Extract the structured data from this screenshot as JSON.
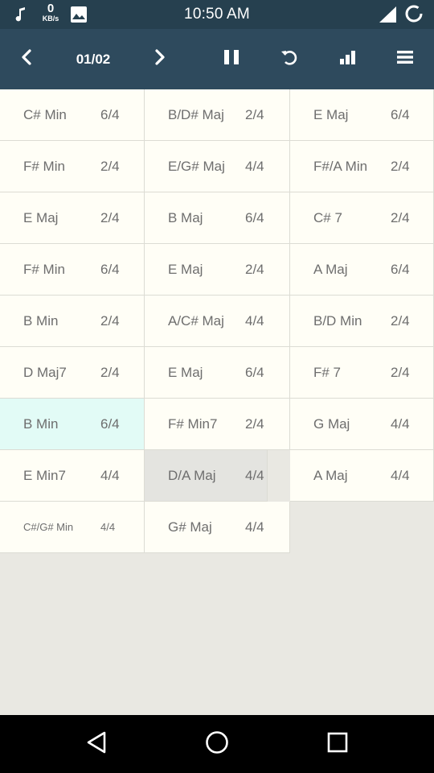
{
  "status_bar": {
    "time": "10:50 AM",
    "network_speed_value": "0",
    "network_speed_unit": "KB/s",
    "icons": [
      "music-note-icon",
      "image-icon",
      "signal-icon",
      "battery-loading-icon"
    ]
  },
  "toolbar": {
    "page_indicator": "01/02",
    "icons": [
      "chevron-left-icon",
      "chevron-right-icon",
      "pause-icon",
      "repeat-icon",
      "bar-chart-icon",
      "menu-icon"
    ]
  },
  "chords": [
    {
      "chord": "C# Min",
      "beat": "6/4"
    },
    {
      "chord": "B/D# Maj",
      "beat": "2/4"
    },
    {
      "chord": "E Maj",
      "beat": "6/4"
    },
    {
      "chord": "F# Min",
      "beat": "2/4"
    },
    {
      "chord": "E/G# Maj",
      "beat": "4/4"
    },
    {
      "chord": "F#/A Min",
      "beat": "2/4"
    },
    {
      "chord": "E Maj",
      "beat": "2/4"
    },
    {
      "chord": "B Maj",
      "beat": "6/4"
    },
    {
      "chord": "C# 7",
      "beat": "2/4"
    },
    {
      "chord": "F# Min",
      "beat": "6/4"
    },
    {
      "chord": "E Maj",
      "beat": "2/4"
    },
    {
      "chord": "A Maj",
      "beat": "6/4"
    },
    {
      "chord": "B Min",
      "beat": "2/4"
    },
    {
      "chord": "A/C# Maj",
      "beat": "4/4"
    },
    {
      "chord": "B/D Min",
      "beat": "2/4"
    },
    {
      "chord": "D Maj7",
      "beat": "2/4"
    },
    {
      "chord": "E Maj",
      "beat": "6/4"
    },
    {
      "chord": "F# 7",
      "beat": "2/4"
    },
    {
      "chord": "B Min",
      "beat": "6/4"
    },
    {
      "chord": "F# Min7",
      "beat": "2/4"
    },
    {
      "chord": "G Maj",
      "beat": "4/4"
    },
    {
      "chord": "E Min7",
      "beat": "4/4"
    },
    {
      "chord": "D/A Maj",
      "beat": "4/4"
    },
    {
      "chord": "A Maj",
      "beat": "4/4"
    },
    {
      "chord": "C#/G# Min",
      "beat": "4/4"
    },
    {
      "chord": "G# Maj",
      "beat": "4/4"
    }
  ],
  "colors": {
    "status_bar_bg": "#26404f",
    "toolbar_bg": "#2e4a5d",
    "cell_bg": "#fffef6",
    "current_cell_bg": "#e2fbf6",
    "pressed_cell_bg": "#e4e4e0",
    "page_bg": "#e9e8e2"
  },
  "nav_bar": {
    "icons": [
      "back-triangle-icon",
      "home-circle-icon",
      "recents-square-icon"
    ]
  }
}
